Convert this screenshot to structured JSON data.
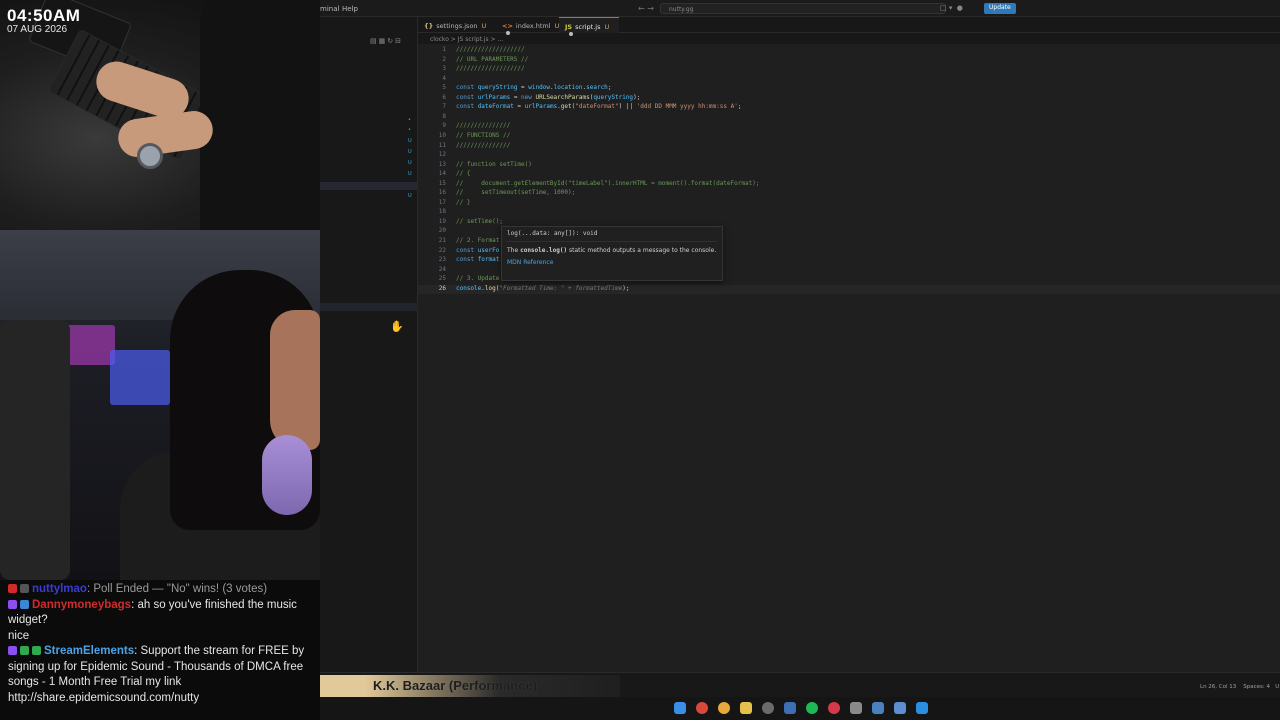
{
  "overlay": {
    "clock_time": "04:50AM",
    "clock_date": "07 AUG 2026"
  },
  "chat": {
    "messages": [
      {
        "user": "nuttylmao",
        "text": ": Poll Ended — \"No\" wins! (3 votes)",
        "user_color": "#3b3bd0"
      },
      {
        "user": "Dannymoneybags",
        "text": ": ah so you've finished the music widget?",
        "user_color": "#d42a2a"
      },
      {
        "user": "",
        "text": "nice",
        "user_color": "#e6e6e6"
      },
      {
        "user": "StreamElements",
        "text": ": Support the stream for FREE by signing up for Epidemic Sound - Thousands of DMCA free songs - 1 Month Free Trial my link http://share.epidemicsound.com/nutty",
        "user_color": "#4aa3e8"
      }
    ]
  },
  "titlebar": {
    "menu_items": [
      "minal",
      "Help"
    ],
    "search_text": "nutty.gg",
    "update_label": "Update"
  },
  "tabs": [
    {
      "icon": "{}",
      "label": "settings.json",
      "status": "U",
      "icon_color": "#d7ba7d",
      "active": false,
      "unsaved": false
    },
    {
      "icon": "<>",
      "label": "index.html",
      "status": "U",
      "icon_color": "#e37933",
      "active": false,
      "unsaved": true
    },
    {
      "icon": "JS",
      "label": "script.js",
      "status": "U",
      "icon_color": "#cbcb41",
      "active": true,
      "unsaved": true
    }
  ],
  "breadcrumb": "clocko  >  JS script.js  >  ...",
  "code_lines": [
    {
      "n": "1",
      "parts": [
        [
          "c-comment",
          "///////////////////"
        ]
      ]
    },
    {
      "n": "2",
      "parts": [
        [
          "c-comment",
          "// URL PARAMETERS //"
        ]
      ]
    },
    {
      "n": "3",
      "parts": [
        [
          "c-comment",
          "///////////////////"
        ]
      ]
    },
    {
      "n": "4",
      "parts": []
    },
    {
      "n": "5",
      "parts": [
        [
          "c-kw",
          "const "
        ],
        [
          "c-var",
          "queryString"
        ],
        [
          "",
          " = "
        ],
        [
          "c-var",
          "window"
        ],
        [
          "",
          "."
        ],
        [
          "c-var",
          "location"
        ],
        [
          "",
          "."
        ],
        [
          "c-var",
          "search"
        ],
        [
          "",
          ";"
        ]
      ]
    },
    {
      "n": "6",
      "parts": [
        [
          "c-kw",
          "const "
        ],
        [
          "c-var",
          "urlParams"
        ],
        [
          "",
          " = "
        ],
        [
          "c-kw",
          "new "
        ],
        [
          "c-fn",
          "URLSearchParams"
        ],
        [
          "",
          "("
        ],
        [
          "c-var",
          "queryString"
        ],
        [
          "",
          ");"
        ]
      ]
    },
    {
      "n": "7",
      "parts": [
        [
          "c-kw",
          "const "
        ],
        [
          "c-var",
          "dateFormat"
        ],
        [
          "",
          " = "
        ],
        [
          "c-var",
          "urlParams"
        ],
        [
          "",
          "."
        ],
        [
          "c-fn",
          "get"
        ],
        [
          "",
          "("
        ],
        [
          "c-str",
          "\"dateFormat\""
        ],
        [
          "",
          ") || "
        ],
        [
          "c-str",
          "'ddd DD MMM yyyy hh:mm:ss A'"
        ],
        [
          "",
          ";"
        ]
      ]
    },
    {
      "n": "8",
      "parts": []
    },
    {
      "n": "9",
      "parts": [
        [
          "c-comment",
          "///////////////"
        ]
      ]
    },
    {
      "n": "10",
      "parts": [
        [
          "c-comment",
          "// FUNCTIONS //"
        ]
      ]
    },
    {
      "n": "11",
      "parts": [
        [
          "c-comment",
          "///////////////"
        ]
      ]
    },
    {
      "n": "12",
      "parts": []
    },
    {
      "n": "13",
      "parts": [
        [
          "c-comment",
          "// function setTime()"
        ]
      ]
    },
    {
      "n": "14",
      "parts": [
        [
          "c-comment",
          "// {"
        ]
      ]
    },
    {
      "n": "15",
      "parts": [
        [
          "c-comment",
          "//     document.getElementById(\"timeLabel\").innerHTML = moment().format(dateFormat);"
        ]
      ]
    },
    {
      "n": "16",
      "parts": [
        [
          "c-comment",
          "//     setTimeout(setTime, 1000);"
        ]
      ]
    },
    {
      "n": "17",
      "parts": [
        [
          "c-comment",
          "// }"
        ]
      ]
    },
    {
      "n": "18",
      "parts": []
    },
    {
      "n": "19",
      "parts": [
        [
          "c-comment",
          "// setTime();"
        ]
      ]
    },
    {
      "n": "20",
      "parts": []
    },
    {
      "n": "21",
      "parts": [
        [
          "c-comment",
          "// 2. Format"
        ]
      ]
    },
    {
      "n": "22",
      "parts": [
        [
          "c-kw",
          "const "
        ],
        [
          "c-var",
          "userFo"
        ]
      ]
    },
    {
      "n": "23",
      "parts": [
        [
          "c-kw",
          "const "
        ],
        [
          "c-var",
          "format"
        ]
      ]
    },
    {
      "n": "24",
      "parts": []
    },
    {
      "n": "25",
      "parts": [
        [
          "c-comment",
          "// 3. Update"
        ]
      ]
    },
    {
      "n": "26",
      "parts": [
        [
          "c-var",
          "console"
        ],
        [
          "",
          "."
        ],
        [
          "c-fn",
          "log"
        ],
        [
          "",
          "("
        ],
        [
          "c-ghost",
          "\"Formatted Time: \" + formattedTime"
        ],
        [
          "",
          ");"
        ]
      ]
    }
  ],
  "hover": {
    "signature": "log(...data: any[]): void",
    "description_prefix": "The",
    "description_code": "console.log()",
    "description_rest": "static method outputs a message to the console.",
    "link": "MDN Reference"
  },
  "now_playing": "K.K. Bazaar (Performance)",
  "statusbar": {
    "position": "Ln 26, Col 13",
    "spaces": "Spaces: 4",
    "encoding": "U"
  },
  "icons": {
    "taskbar": [
      "windows-start",
      "chrome",
      "chrome-alt",
      "file-explorer",
      "settings",
      "vpn",
      "spotify",
      "music",
      "unity",
      "terminal",
      "app",
      "vscode"
    ]
  },
  "colors": {
    "accent": "#3c8fd6",
    "update_button": "#2f79b8",
    "now_playing_bg": "#e2c99a"
  }
}
